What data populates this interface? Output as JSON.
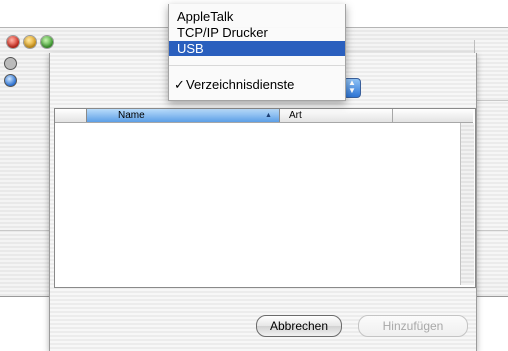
{
  "menu": {
    "items": [
      {
        "label": "AppleTalk"
      },
      {
        "label": "TCP/IP Drucker"
      },
      {
        "label": "USB",
        "highlighted": true
      },
      {
        "label": "Verzeichnisdienste",
        "checked": true
      }
    ],
    "highlight_color": "#2a5fbe"
  },
  "list": {
    "columns": [
      "Name",
      "Art"
    ],
    "rows": []
  },
  "buttons": {
    "cancel": "Abbrechen",
    "add": "Hinzufügen"
  },
  "icons": {
    "check": "✓",
    "sort": "▲"
  },
  "colors": {
    "close": "#d52b1e",
    "minimize": "#e0a11b",
    "zoom": "#41a532",
    "header_selected": "#5c9fe6"
  }
}
